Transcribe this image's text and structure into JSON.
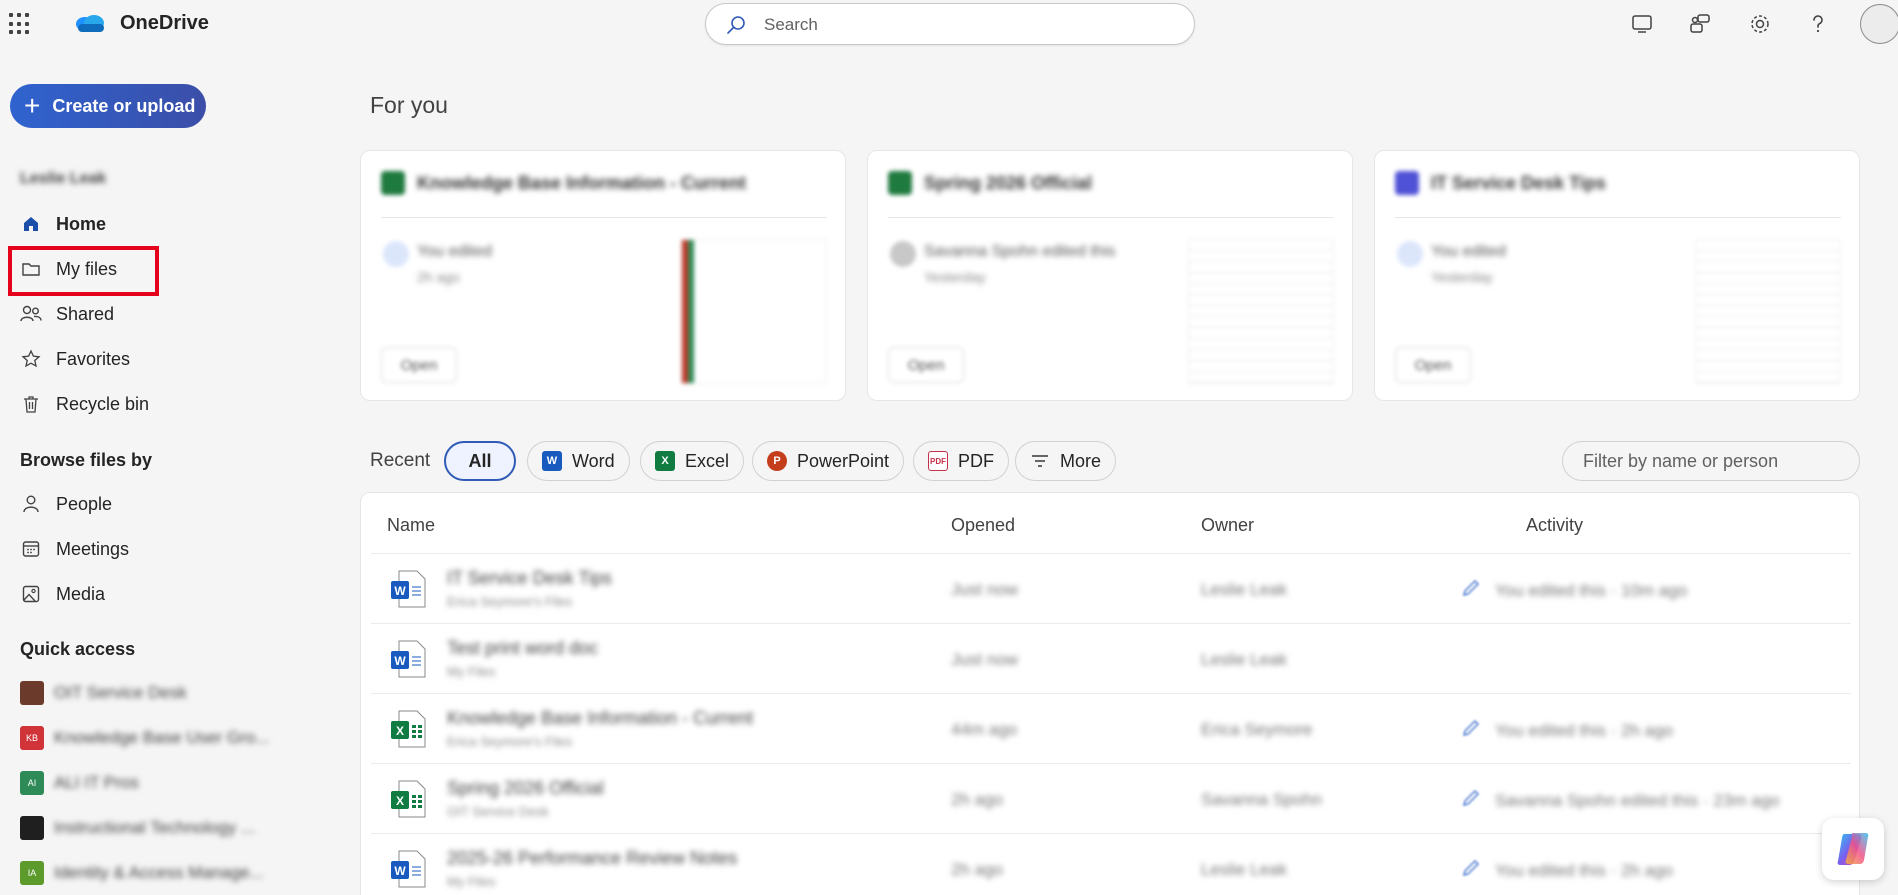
{
  "app": {
    "brand": "OneDrive",
    "accent": "#2f63cf",
    "highlight_color": "#e5001c"
  },
  "search": {
    "placeholder": "Search"
  },
  "toolbar_icons": [
    "monitor-icon",
    "feedback-icon",
    "gear-icon",
    "help-icon",
    "avatar"
  ],
  "sidebar": {
    "create_label": "Create or upload",
    "user_name": "Leslie Leak",
    "items": [
      {
        "label": "Home",
        "icon": "home-icon",
        "active": true
      },
      {
        "label": "My files",
        "icon": "folder-icon",
        "active": false,
        "highlighted": true
      },
      {
        "label": "Shared",
        "icon": "people-icon",
        "active": false
      },
      {
        "label": "Favorites",
        "icon": "star-icon",
        "active": false
      },
      {
        "label": "Recycle bin",
        "icon": "trash-icon",
        "active": false
      }
    ],
    "browse_title": "Browse files by",
    "browse_items": [
      {
        "label": "People",
        "icon": "person-icon"
      },
      {
        "label": "Meetings",
        "icon": "calendar-icon"
      },
      {
        "label": "Media",
        "icon": "image-icon"
      }
    ],
    "quick_access_title": "Quick access",
    "quick_access": [
      {
        "label": "OIT Service Desk",
        "initials": "",
        "color": "#6b3a2a"
      },
      {
        "label": "Knowledge Base User Gro...",
        "initials": "KB",
        "color": "#d13438"
      },
      {
        "label": "ALI IT Pros",
        "initials": "AI",
        "color": "#2e8b57"
      },
      {
        "label": "Instructional Technology ...",
        "initials": "",
        "color": "#1f1f1f"
      },
      {
        "label": "Identity & Access Manage...",
        "initials": "IA",
        "color": "#5c9a2c"
      }
    ]
  },
  "main": {
    "for_you_title": "For you",
    "cards": [
      {
        "title": "Knowledge Base Information - Current",
        "activity": "You edited",
        "time": "2h ago",
        "open_label": "Open",
        "icon_color": "#1f7a3f"
      },
      {
        "title": "Spring 2026 Official",
        "activity": "Savanna Spohn edited this",
        "time": "Yesterday",
        "open_label": "Open",
        "icon_color": "#1f7a3f"
      },
      {
        "title": "IT Service Desk Tips",
        "activity": "You edited",
        "time": "Yesterday",
        "open_label": "Open",
        "icon_color": "#4f52d6"
      }
    ],
    "recent_label": "Recent",
    "chips": [
      {
        "label": "All",
        "selected": true
      },
      {
        "label": "Word",
        "icon": "word-icon"
      },
      {
        "label": "Excel",
        "icon": "excel-icon"
      },
      {
        "label": "PowerPoint",
        "icon": "powerpoint-icon"
      },
      {
        "label": "PDF",
        "icon": "pdf-icon"
      },
      {
        "label": "More",
        "icon": "filter-lines-icon"
      }
    ],
    "filter_placeholder": "Filter by name or person",
    "columns": [
      "Name",
      "Opened",
      "Owner",
      "Activity"
    ],
    "rows": [
      {
        "type": "word",
        "name": "IT Service Desk Tips",
        "location": "Erica Seymore's Files",
        "opened": "Just now",
        "owner": "Leslie Leak",
        "activity": "You edited this · 10m ago"
      },
      {
        "type": "word",
        "name": "Test print word doc",
        "location": "My Files",
        "opened": "Just now",
        "owner": "Leslie Leak",
        "activity": ""
      },
      {
        "type": "excel",
        "name": "Knowledge Base Information - Current",
        "location": "Erica Seymore's Files",
        "opened": "44m ago",
        "owner": "Erica Seymore",
        "activity": "You edited this · 2h ago"
      },
      {
        "type": "excel",
        "name": "Spring 2026 Official",
        "location": "OIT Service Desk",
        "opened": "2h ago",
        "owner": "Savanna Spohn",
        "activity": "Savanna Spohn edited this · 23m ago"
      },
      {
        "type": "word",
        "name": "2025-26 Performance Review Notes",
        "location": "My Files",
        "opened": "2h ago",
        "owner": "Leslie Leak",
        "activity": "You edited this · 2h ago"
      }
    ]
  }
}
